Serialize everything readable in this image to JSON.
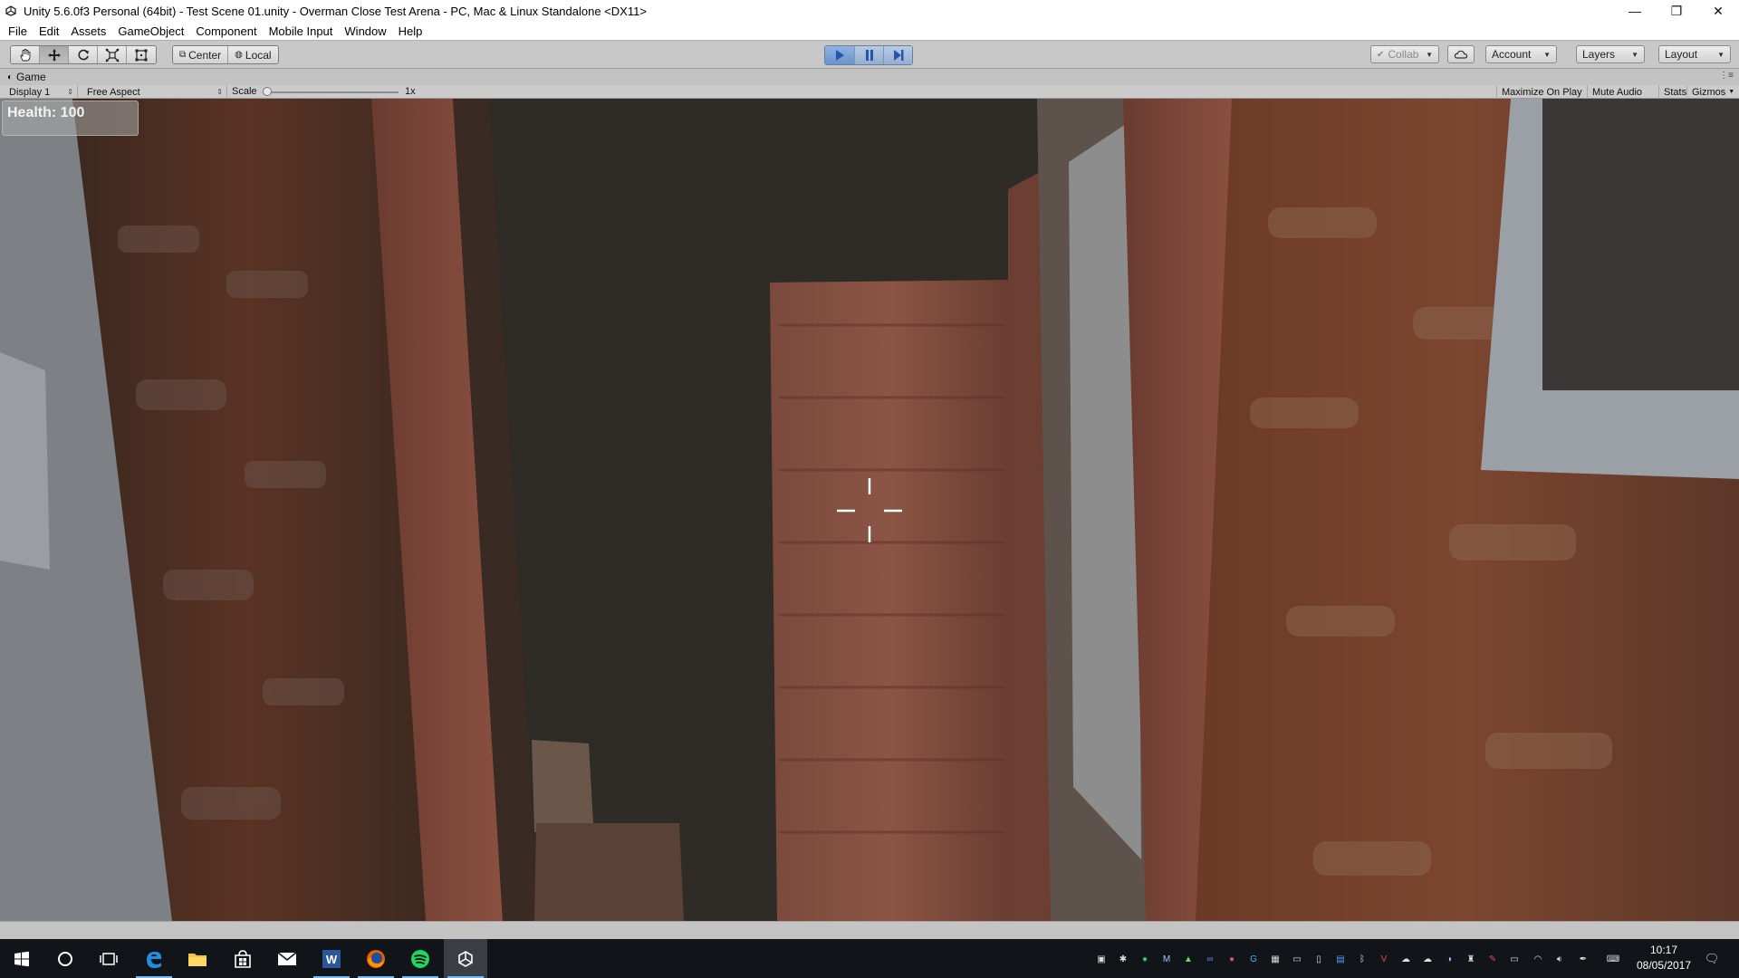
{
  "window": {
    "title": "Unity 5.6.0f3 Personal (64bit) - Test Scene 01.unity - Overman Close Test Arena - PC, Mac & Linux Standalone <DX11>",
    "minimize_glyph": "—",
    "maximize_glyph": "❐",
    "close_glyph": "✕"
  },
  "menu": [
    "File",
    "Edit",
    "Assets",
    "GameObject",
    "Component",
    "Mobile Input",
    "Window",
    "Help"
  ],
  "toolbar": {
    "tools": [
      "hand-tool",
      "move-tool",
      "rotate-tool",
      "scale-tool",
      "rect-tool"
    ],
    "pivot_mode": "Center",
    "pivot_rotation": "Local",
    "collab": "Collab",
    "account": "Account",
    "layers": "Layers",
    "layout": "Layout"
  },
  "game_view": {
    "tab_label": "Game",
    "display": "Display 1",
    "aspect": "Free Aspect",
    "scale_label": "Scale",
    "scale_value": "1x",
    "maximize_on_play": "Maximize On Play",
    "mute_audio": "Mute Audio",
    "stats": "Stats",
    "gizmos": "Gizmos"
  },
  "hud": {
    "health": "Health: 100"
  },
  "taskbar": {
    "apps": [
      "start",
      "cortana",
      "task-view",
      "edge",
      "file-explorer",
      "store",
      "mail",
      "word",
      "firefox",
      "spotify",
      "unity"
    ],
    "time": "10:17",
    "date": "08/05/2017"
  },
  "colors": {
    "accent_play": "#94aed2",
    "taskbar": "#111418",
    "toolbar": "#c8c8c8"
  }
}
